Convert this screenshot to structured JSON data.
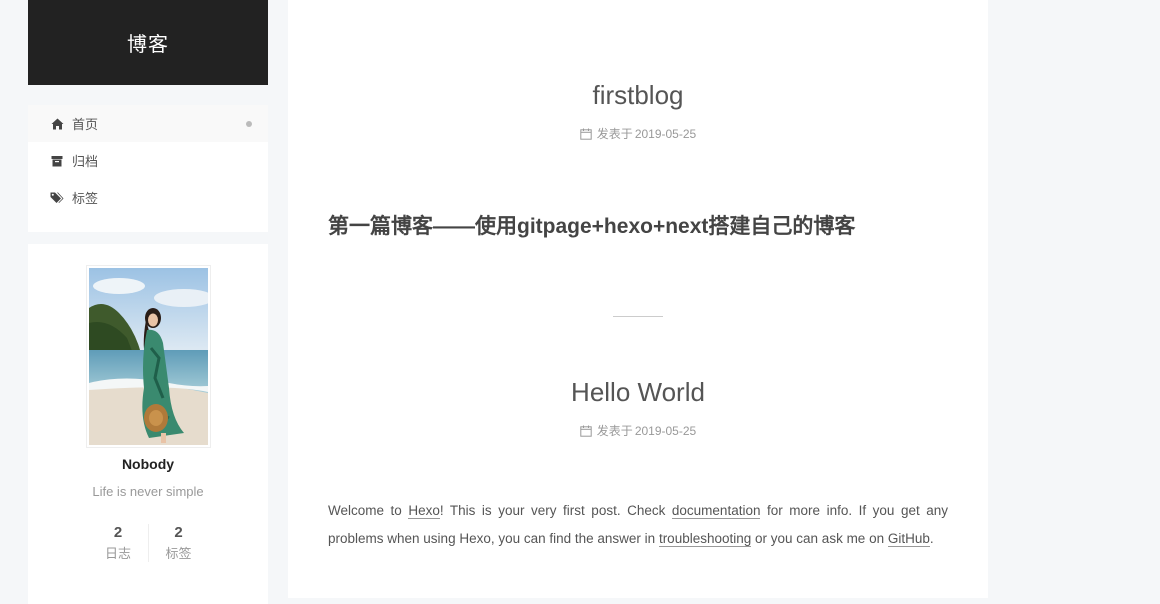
{
  "site": {
    "title": "博客"
  },
  "menu": {
    "items": [
      {
        "label": "首页",
        "icon": "home-icon",
        "active": true
      },
      {
        "label": "归档",
        "icon": "archive-icon",
        "active": false
      },
      {
        "label": "标签",
        "icon": "tags-icon",
        "active": false
      }
    ]
  },
  "author": {
    "name": "Nobody",
    "description": "Life is never simple",
    "stats": [
      {
        "count": "2",
        "label": "日志"
      },
      {
        "count": "2",
        "label": "标签"
      }
    ]
  },
  "posts": [
    {
      "title": "firstblog",
      "meta_label": "发表于",
      "date": "2019-05-25",
      "heading": "第一篇博客——使用gitpage+hexo+next搭建自己的博客"
    },
    {
      "title": "Hello World",
      "meta_label": "发表于",
      "date": "2019-05-25",
      "para": {
        "t1": "Welcome to ",
        "link_hexo": "Hexo",
        "t2": "! This is your very first post. Check ",
        "link_docs": "documentation",
        "t3": " for more info. If you get any problems when using Hexo, you can find the answer in ",
        "link_trouble": "troubleshooting",
        "t4": " or you can ask me on ",
        "link_github": "GitHub",
        "t5": "."
      }
    }
  ],
  "colors": {
    "brand_bg": "#222222",
    "page_bg": "#f5f7f9",
    "text": "#555555"
  }
}
